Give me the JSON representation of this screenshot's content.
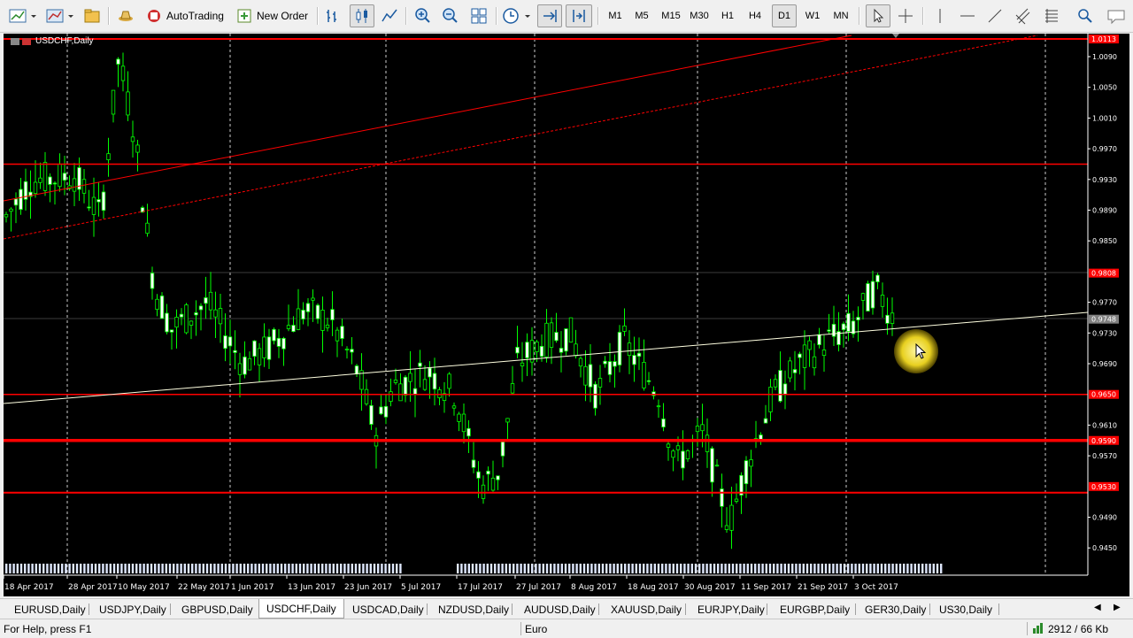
{
  "toolbar": {
    "autotrading_label": "AutoTrading",
    "new_order_label": "New Order",
    "timeframes": [
      "M1",
      "M5",
      "M15",
      "M30",
      "H1",
      "H4",
      "D1",
      "W1",
      "MN"
    ],
    "active_timeframe": "D1"
  },
  "chart": {
    "title": "USDCHF,Daily",
    "price_labels": [
      "1.0113",
      "1.0090",
      "1.0050",
      "1.0010",
      "0.9970",
      "0.9930",
      "0.9890",
      "0.9850",
      "0.9808",
      "0.9770",
      "0.9748",
      "0.9730",
      "0.9690",
      "0.9650",
      "0.9610",
      "0.9590",
      "0.9570",
      "0.9530",
      "0.9490",
      "0.9450"
    ],
    "highlighted_prices": {
      "1.0113": "red",
      "0.9808": "red",
      "0.9748": "gray",
      "0.9650": "red",
      "0.9590": "red",
      "0.9530": "red"
    },
    "date_labels": [
      "18 Apr 2017",
      "28 Apr 2017",
      "10 May 2017",
      "22 May 2017",
      "1 Jun 2017",
      "13 Jun 2017",
      "23 Jun 2017",
      "5 Jul 2017",
      "17 Jul 2017",
      "27 Jul 2017",
      "8 Aug 2017",
      "18 Aug 2017",
      "30 Aug 2017",
      "11 Sep 2017",
      "21 Sep 2017",
      "3 Oct 2017"
    ],
    "line_colors": {
      "candle": "#00ff00",
      "support": "#ff0000",
      "trend": "#ffffe0",
      "background": "#000000"
    }
  },
  "tabs": [
    "EURUSD,Daily",
    "USDJPY,Daily",
    "GBPUSD,Daily",
    "USDCHF,Daily",
    "USDCAD,Daily",
    "NZDUSD,Daily",
    "AUDUSD,Daily",
    "XAUUSD,Daily",
    "EURJPY,Daily",
    "EURGBP,Daily",
    "GER30,Daily",
    "US30,Daily"
  ],
  "active_tab": "USDCHF,Daily",
  "status": {
    "help": "For Help, press F1",
    "profile": "Euro",
    "traffic": "2912 / 66 Kb"
  }
}
